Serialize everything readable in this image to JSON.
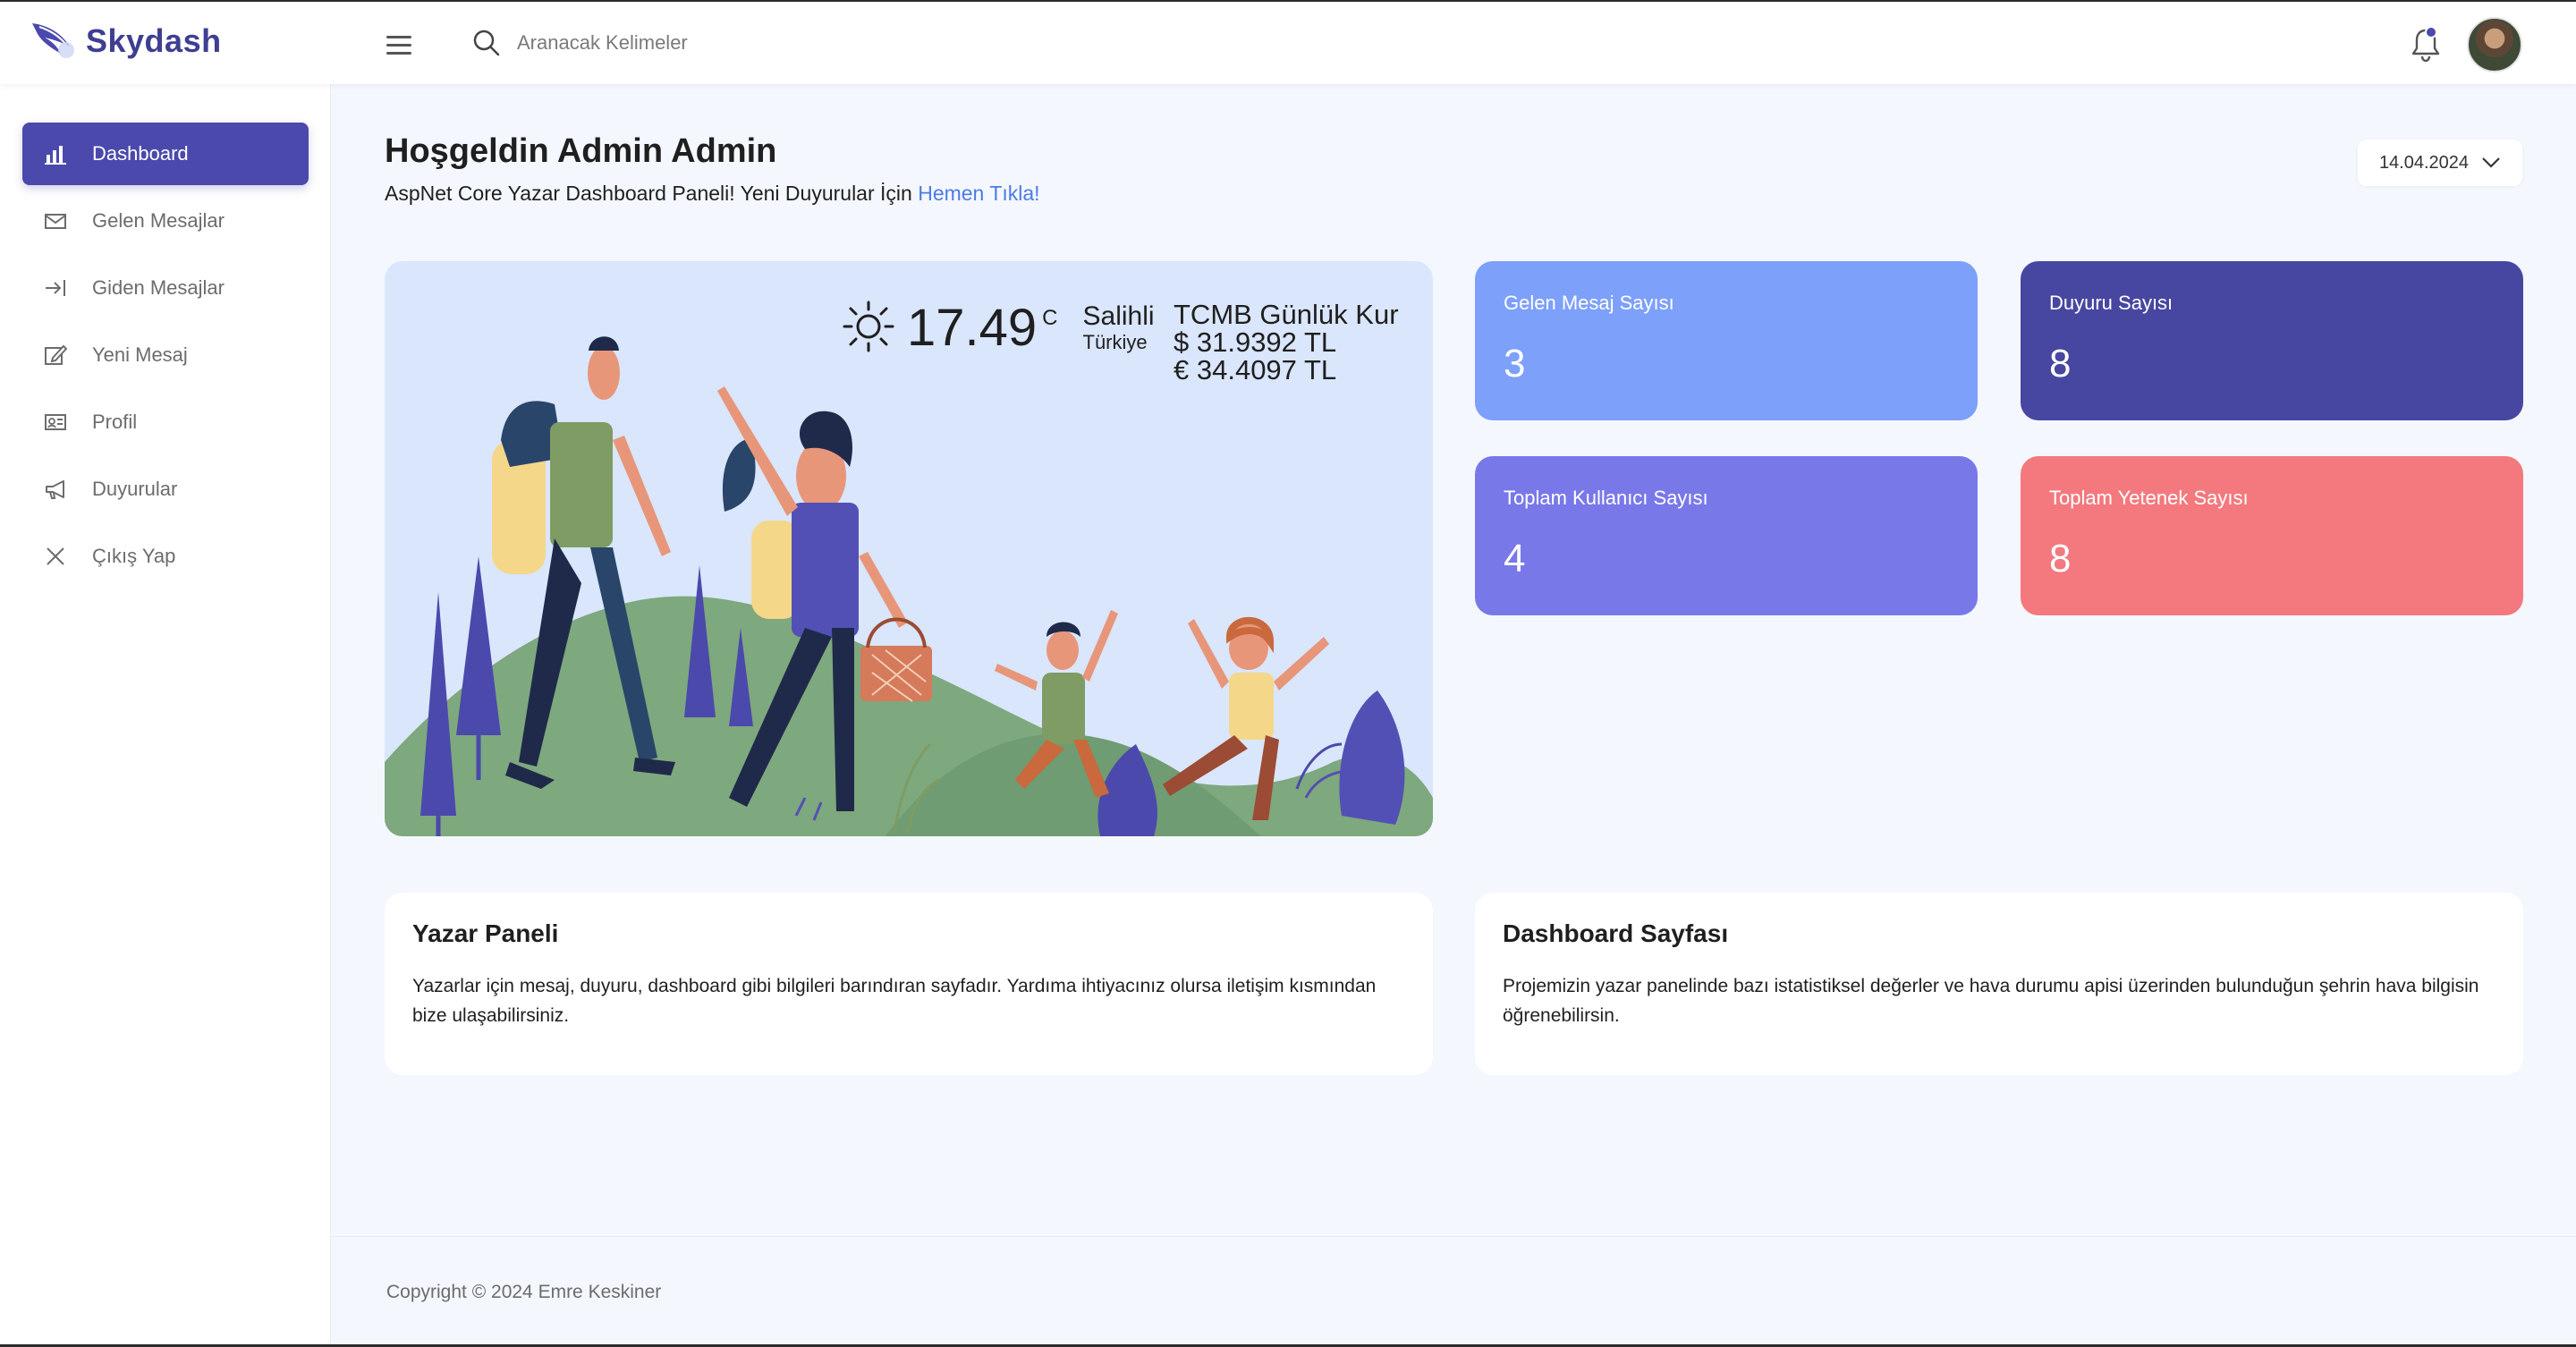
{
  "brand": {
    "name": "Skydash"
  },
  "search": {
    "placeholder": "Aranacak Kelimeler"
  },
  "sidebar": {
    "items": [
      {
        "label": "Dashboard",
        "icon": "bar-chart-icon",
        "active": true
      },
      {
        "label": "Gelen Mesajlar",
        "icon": "envelope-icon"
      },
      {
        "label": "Giden Mesajlar",
        "icon": "arrow-right-bar-icon"
      },
      {
        "label": "Yeni Mesaj",
        "icon": "edit-icon"
      },
      {
        "label": "Profil",
        "icon": "id-card-icon"
      },
      {
        "label": "Duyurular",
        "icon": "megaphone-icon"
      },
      {
        "label": "Çıkış Yap",
        "icon": "close-icon"
      }
    ]
  },
  "welcome": {
    "title": "Hoşgeldin Admin Admin",
    "subtitle": "AspNet Core Yazar Dashboard Paneli! Yeni Duyurular İçin ",
    "link": "Hemen Tıkla!"
  },
  "date": {
    "value": "14.04.2024"
  },
  "weather": {
    "temperature": "17.49",
    "unit": "C",
    "city": "Salihli",
    "country": "Türkiye",
    "icon": "sun-icon"
  },
  "currency": {
    "title": "TCMB Günlük Kur",
    "usd": "$ 31.9392 TL",
    "eur": "€ 34.4097 TL"
  },
  "stats": [
    {
      "label": "Gelen Mesaj Sayısı",
      "value": "3",
      "color": "#7da0fa"
    },
    {
      "label": "Duyuru Sayısı",
      "value": "8",
      "color": "#4747a1"
    },
    {
      "label": "Toplam Kullanıcı Sayısı",
      "value": "4",
      "color": "#7978e9"
    },
    {
      "label": "Toplam Yetenek Sayısı",
      "value": "8",
      "color": "#f3797e"
    }
  ],
  "info": [
    {
      "title": "Yazar Paneli",
      "text": "Yazarlar için mesaj, duyuru, dashboard gibi bilgileri barındıran sayfadır. Yardıma ihtiyacınız olursa iletişim kısmından bize ulaşabilirsiniz."
    },
    {
      "title": "Dashboard Sayfası",
      "text": "Projemizin yazar panelinde bazı istatistiksel değerler ve hava durumu apisi üzerinden bulunduğun şehrin hava bilgisin öğrenebilirsin."
    }
  ],
  "footer": {
    "text": "Copyright © 2024 Emre Keskiner"
  },
  "colors": {
    "primary": "#4b49ac",
    "background": "#f4f7fe",
    "hero": "#dae6fc",
    "link": "#4b7be5"
  }
}
